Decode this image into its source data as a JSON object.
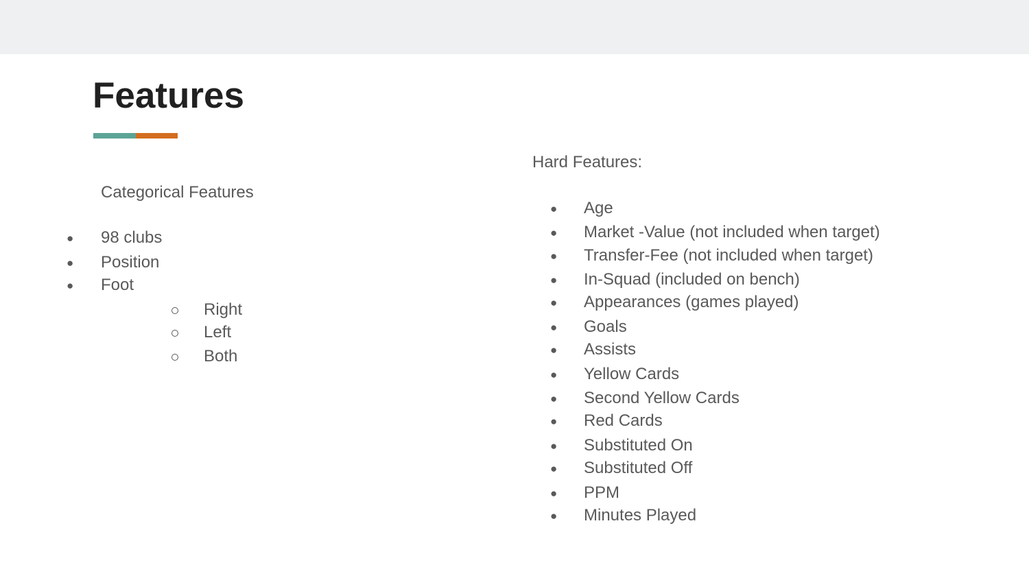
{
  "slide": {
    "title": "Features",
    "accent_colors": [
      "#5ca496",
      "#d46d1f"
    ]
  },
  "left_column": {
    "heading": "Categorical Features",
    "items": [
      {
        "label": "98 clubs"
      },
      {
        "label": "Position"
      },
      {
        "label": "Foot",
        "subitems": [
          "Right",
          "Left",
          "Both"
        ]
      }
    ]
  },
  "right_column": {
    "heading": "Hard Features:",
    "items": [
      "Age",
      "Market -Value (not included when target)",
      "Transfer-Fee (not included when target)",
      "In-Squad (included on bench)",
      "Appearances (games played)",
      "Goals",
      "Assists",
      "Yellow Cards",
      "Second Yellow Cards",
      "Red Cards",
      "Substituted On",
      "Substituted Off",
      "PPM",
      "Minutes Played"
    ]
  }
}
